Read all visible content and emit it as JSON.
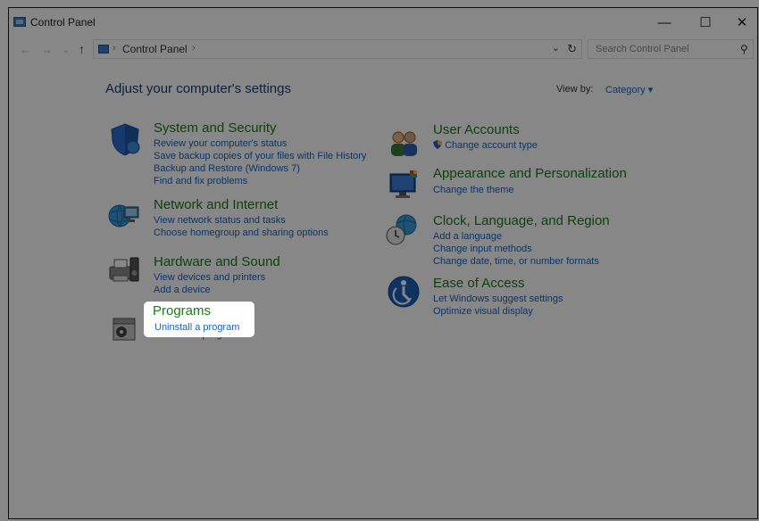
{
  "window": {
    "title": "Control Panel",
    "controls": {
      "minimize": "—",
      "maximize": "☐",
      "close": "✕"
    }
  },
  "address": {
    "back": "←",
    "forward": "→",
    "up": "↑",
    "sep1": "›",
    "crumb": "Control Panel",
    "sep2": "›",
    "dropdown": "⌄",
    "refresh": "↻",
    "search_placeholder": "Search Control Panel",
    "search_glyph": "⚲"
  },
  "main": {
    "heading": "Adjust your computer's settings",
    "view_by_label": "View by:",
    "view_by_value": "Category ▾"
  },
  "categories": {
    "system": {
      "title": "System and Security",
      "links": [
        "Review your computer's status",
        "Save backup copies of your files with File History",
        "Backup and Restore (Windows 7)",
        "Find and fix problems"
      ]
    },
    "network": {
      "title": "Network and Internet",
      "links": [
        "View network status and tasks",
        "Choose homegroup and sharing options"
      ]
    },
    "hardware": {
      "title": "Hardware and Sound",
      "links": [
        "View devices and printers",
        "Add a device"
      ]
    },
    "programs": {
      "title": "Programs",
      "links": [
        "Uninstall a program"
      ]
    },
    "users": {
      "title": "User Accounts",
      "links": [
        "Change account type"
      ]
    },
    "appearance": {
      "title": "Appearance and Personalization",
      "links": [
        "Change the theme"
      ]
    },
    "clock": {
      "title": "Clock, Language, and Region",
      "links": [
        "Add a language",
        "Change input methods",
        "Change date, time, or number formats"
      ]
    },
    "ease": {
      "title": "Ease of Access",
      "links": [
        "Let Windows suggest settings",
        "Optimize visual display"
      ]
    }
  },
  "colors": {
    "category_title": "#1a7a1a",
    "link": "#1763c5",
    "heading": "#1a3d7c",
    "dim_overlay": "rgba(0,0,0,0.47)"
  }
}
